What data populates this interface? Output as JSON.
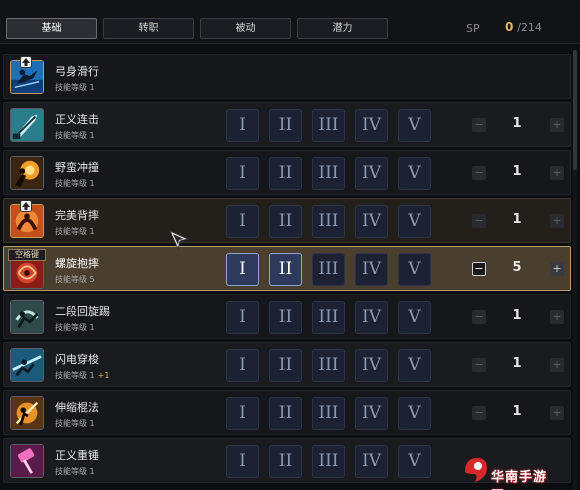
{
  "tabs": [
    {
      "label": "基础",
      "active": true
    },
    {
      "label": "转职",
      "active": false
    },
    {
      "label": "被动",
      "active": false
    },
    {
      "label": "潜力",
      "active": false
    }
  ],
  "sp": {
    "label": "SP",
    "current": "0",
    "separator": "/",
    "max": "214"
  },
  "skill_level_label": "技能等级",
  "runes": [
    "I",
    "II",
    "III",
    "IV",
    "V"
  ],
  "skills": [
    {
      "name": "弓身滑行",
      "level": "1",
      "bonus": "",
      "has_runes": false,
      "badge": "up-arrow"
    },
    {
      "name": "正义连击",
      "level": "1",
      "bonus": "",
      "has_runes": true,
      "runes_on": 0
    },
    {
      "name": "野蛮冲撞",
      "level": "1",
      "bonus": "",
      "has_runes": true,
      "runes_on": 0
    },
    {
      "name": "完美背摔",
      "level": "1",
      "bonus": "",
      "has_runes": true,
      "runes_on": 0,
      "badge": "up-arrow"
    },
    {
      "name": "螺旋抱摔",
      "level": "5",
      "bonus": "",
      "has_runes": true,
      "runes_on": 2,
      "selected": true,
      "key_badge": "空格键"
    },
    {
      "name": "二段回旋踢",
      "level": "1",
      "bonus": "",
      "has_runes": true,
      "runes_on": 0
    },
    {
      "name": "闪电穿梭",
      "level": "1",
      "bonus": "+1",
      "has_runes": true,
      "runes_on": 0
    },
    {
      "name": "伸缩棍法",
      "level": "1",
      "bonus": "",
      "has_runes": true,
      "runes_on": 0
    },
    {
      "name": "正义重锤",
      "level": "1",
      "bonus": "",
      "has_runes": true,
      "runes_on": 0
    }
  ],
  "steppers": {
    "minus": "−",
    "plus": "+"
  },
  "watermark": {
    "text": "华南手游网"
  },
  "colors": {
    "accent_gold": "#e2b45a",
    "rune_active": "#2e3a5c",
    "selected_row": "#4a3e2f"
  }
}
